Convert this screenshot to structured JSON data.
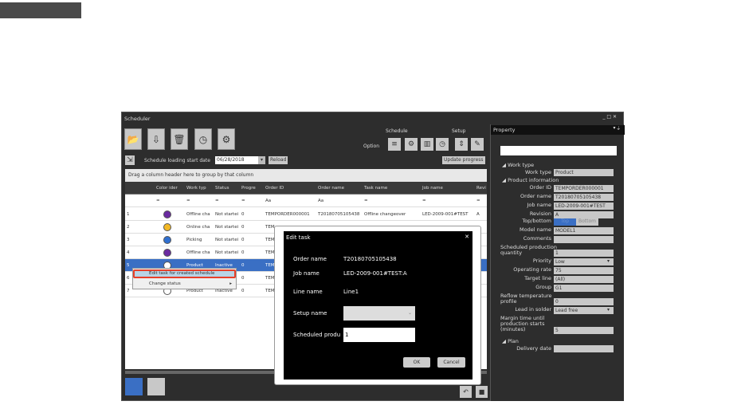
{
  "window": {
    "title": "Scheduler",
    "option": "Option",
    "schedule_group": "Schedule",
    "setup_group": "Setup",
    "load_label": "Schedule loading start date",
    "load_date": "06/28/2018",
    "reload": "Reload",
    "update_progress": "Update progress",
    "group_hint": "Drag a column header here to group by that column"
  },
  "grid": {
    "columns": [
      "",
      "",
      "Color ider",
      "Work typ",
      "Status",
      "Progre",
      "Order ID",
      "Order name",
      "Task name",
      "Job name",
      "Revi"
    ],
    "filter": [
      "",
      "",
      "=",
      "=",
      "=",
      "=",
      "Aa",
      "Aa",
      "=",
      "=",
      "="
    ],
    "rows": [
      {
        "n": "1",
        "color": "#6a2aa0",
        "work": "Offline cha",
        "status": "Not startei",
        "prog": "0",
        "order": "TEMPORDER000001",
        "oname": "T20180705105438",
        "task": "Offline changeover",
        "job": "LED-2009-001#TEST",
        "rev": "A"
      },
      {
        "n": "2",
        "color": "#f2b825",
        "work": "Online cha",
        "status": "Not startei",
        "prog": "0",
        "order": "TEM",
        "oname": "",
        "task": "",
        "job": "",
        "rev": ""
      },
      {
        "n": "3",
        "color": "#2f6fd0",
        "work": "Picking",
        "status": "Not startei",
        "prog": "0",
        "order": "TEM",
        "oname": "",
        "task": "",
        "job": "",
        "rev": ""
      },
      {
        "n": "4",
        "color": "#6a2aa0",
        "work": "Offline cha",
        "status": "Not startei",
        "prog": "0",
        "order": "TEM",
        "oname": "",
        "task": "",
        "job": "",
        "rev": ""
      },
      {
        "n": "5",
        "color": "#ffffff",
        "work": "Product",
        "status": "Inactive",
        "prog": "0",
        "order": "TEM",
        "oname": "",
        "task": "",
        "job": "",
        "rev": ""
      },
      {
        "n": "6",
        "color": "#ffffff",
        "work": "",
        "status": "",
        "prog": "0",
        "order": "TEM",
        "oname": "",
        "task": "",
        "job": "",
        "rev": ""
      },
      {
        "n": "7",
        "color": "#ffffff",
        "work": "Product",
        "status": "Inactive",
        "prog": "0",
        "order": "TEM",
        "oname": "",
        "task": "",
        "job": "",
        "rev": ""
      }
    ]
  },
  "context_menu": {
    "items": [
      "Edit task for created schedule",
      "Change status"
    ]
  },
  "dialog": {
    "title": "Edit task",
    "order_name_label": "Order name",
    "order_name": "T20180705105438",
    "job_name_label": "Job name",
    "job_name": "LED-2009-001#TEST:A",
    "line_name_label": "Line name",
    "line_name": "Line1",
    "setup_label": "Setup name",
    "setup_value": "",
    "qty_label": "Scheduled produ",
    "qty": "1",
    "ok": "OK",
    "cancel": "Cancel"
  },
  "property": {
    "title": "Property",
    "sec_work": "Work type",
    "sec_product": "Product information",
    "sec_plan": "Plan",
    "work_type_label": "Work type",
    "work_type": "Product",
    "fields": [
      {
        "label": "Order ID",
        "value": "TEMPORDER000001"
      },
      {
        "label": "Order name",
        "value": "T20180705105438"
      },
      {
        "label": "Job name",
        "value": "LED-2009-001#TEST"
      },
      {
        "label": "Revision",
        "value": "A"
      }
    ],
    "topbottom_label": "Top/bottom",
    "top": "Top",
    "bottom": "Bottom",
    "fields2": [
      {
        "label": "Model name",
        "value": "MODEL1"
      },
      {
        "label": "Comments",
        "value": ""
      },
      {
        "label": "Scheduled production quantity",
        "value": "1"
      },
      {
        "label": "Priority",
        "value": "Low"
      },
      {
        "label": "Operating rate",
        "value": "75"
      },
      {
        "label": "Target line",
        "value": "(All)"
      },
      {
        "label": "Group",
        "value": "G1"
      },
      {
        "label": "Reflow temperature profile",
        "value": "0"
      },
      {
        "label": "Lead in solder",
        "value": "Lead free"
      },
      {
        "label": "Margin time until production starts (minutes)",
        "value": "5"
      }
    ],
    "delivery_label": "Delivery date",
    "delivery": ""
  },
  "colors": {
    "accent": "#3a6fc4",
    "highlight": "#e8402a"
  }
}
